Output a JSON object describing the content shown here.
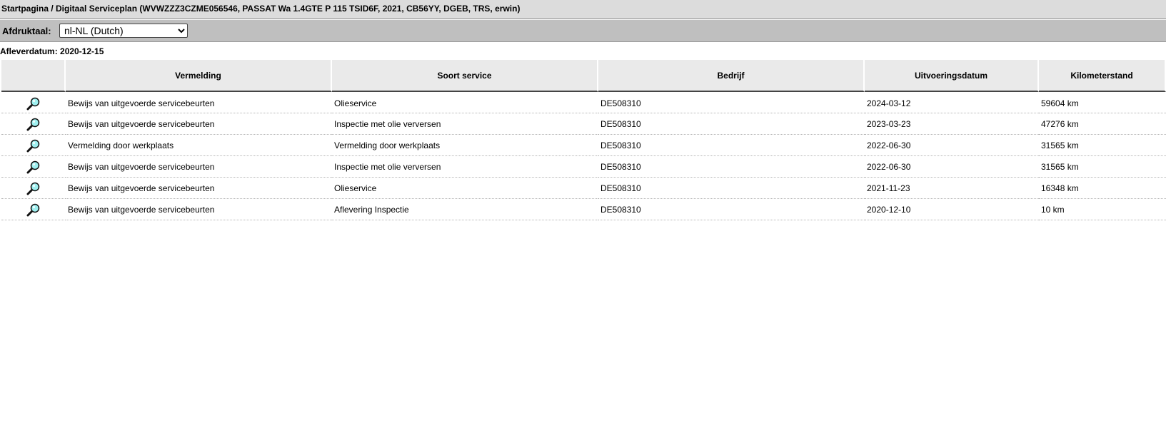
{
  "header": {
    "title": "Startpagina / Digitaal Serviceplan (WVWZZZ3CZME056546, PASSAT Wa 1.4GTE P 115 TSID6F, 2021, CB56YY, DGEB, TRS, erwin)"
  },
  "language": {
    "label": "Afdruktaal:",
    "selected": "nl-NL (Dutch)"
  },
  "delivery": {
    "text": "Afleverdatum: 2020-12-15"
  },
  "table": {
    "columns": [
      "",
      "Vermelding",
      "Soort service",
      "Bedrijf",
      "Uitvoeringsdatum",
      "Kilometerstand"
    ],
    "row_icon": "magnifier-icon",
    "rows": [
      {
        "entry": "Bewijs van uitgevoerde servicebeurten",
        "service": "Olieservice",
        "company": "DE508310",
        "date": "2024-03-12",
        "km": "59604 km"
      },
      {
        "entry": "Bewijs van uitgevoerde servicebeurten",
        "service": "Inspectie met olie verversen",
        "company": "DE508310",
        "date": "2023-03-23",
        "km": "47276 km"
      },
      {
        "entry": "Vermelding door werkplaats",
        "service": "Vermelding door werkplaats",
        "company": "DE508310",
        "date": "2022-06-30",
        "km": "31565 km"
      },
      {
        "entry": "Bewijs van uitgevoerde servicebeurten",
        "service": "Inspectie met olie verversen",
        "company": "DE508310",
        "date": "2022-06-30",
        "km": "31565 km"
      },
      {
        "entry": "Bewijs van uitgevoerde servicebeurten",
        "service": "Olieservice",
        "company": "DE508310",
        "date": "2021-11-23",
        "km": "16348 km"
      },
      {
        "entry": "Bewijs van uitgevoerde servicebeurten",
        "service": "Aflevering Inspectie",
        "company": "DE508310",
        "date": "2020-12-10",
        "km": "10 km"
      }
    ]
  }
}
